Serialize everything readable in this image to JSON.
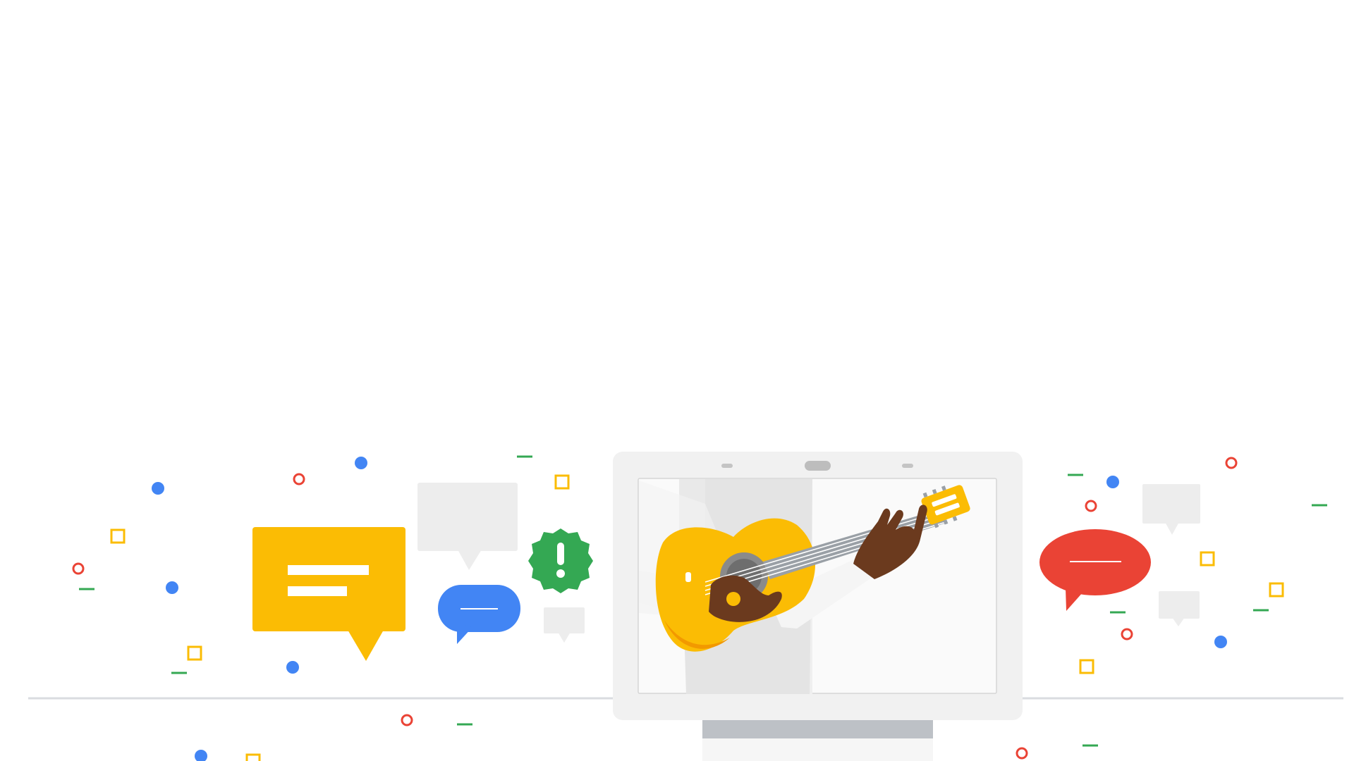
{
  "illustration": {
    "subject": "",
    "colors": {
      "yellow": "#FBBC04",
      "blue": "#4285F4",
      "green": "#34A853",
      "red": "#EA4335",
      "light_gray": "#EDEDED",
      "device_frame": "#F1F1F1",
      "device_stand": "#BDC1C6",
      "floor_line": "#DADCE0",
      "skin": "#6B3A1E",
      "sleeve": "#F5F5F5",
      "guitar_body": "#FBBC04",
      "guitar_shade": "#F29900"
    },
    "icons": [
      "yellow-chat-bubble-icon",
      "gray-chat-bubble-icon",
      "blue-chat-bubble-icon",
      "green-alert-badge-icon",
      "red-chat-bubble-icon",
      "smart-display-device-icon",
      "guitar-icon"
    ],
    "alert_badge_glyph": "!"
  }
}
